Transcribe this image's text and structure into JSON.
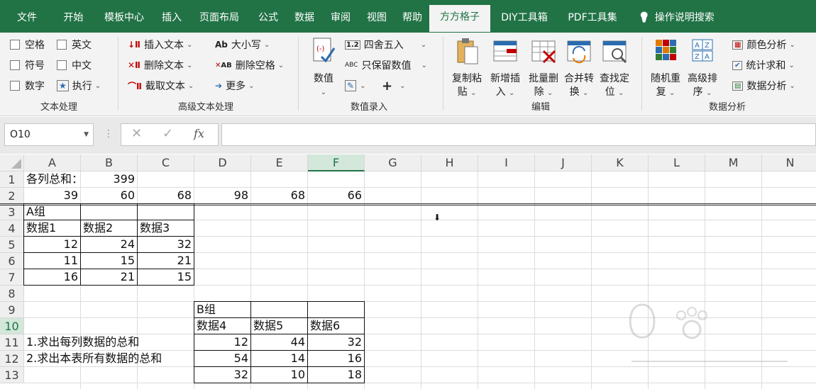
{
  "tabs": [
    "文件",
    "开始",
    "模板中心",
    "插入",
    "页面布局",
    "公式",
    "数据",
    "审阅",
    "视图",
    "帮助",
    "方方格子",
    "DIY工具箱",
    "PDF工具集",
    "操作说明搜索"
  ],
  "ribbon": {
    "text_group": {
      "title": "文本处理",
      "items": [
        "空格",
        "英文",
        "符号",
        "中文",
        "数字",
        "执行"
      ]
    },
    "adv_group": {
      "title": "高级文本处理",
      "items": [
        "插入文本",
        "删除文本",
        "截取文本",
        "大小写",
        "删除空格",
        "更多"
      ]
    },
    "num_group": {
      "title": "数值录入",
      "value_label": "数值",
      "items": [
        "四舍五入",
        "只保留数值"
      ],
      "plus": "+"
    },
    "edit_group": {
      "title": "编辑",
      "buttons": [
        [
          "复制粘",
          "贴"
        ],
        [
          "新增插",
          "入"
        ],
        [
          "批量删",
          "除"
        ],
        [
          "合并转",
          "换"
        ],
        [
          "查找定",
          "位"
        ]
      ]
    },
    "analysis_group": {
      "title": "数据分析",
      "buttons": [
        [
          "随机重",
          "复"
        ],
        [
          "高级排",
          "序"
        ]
      ],
      "items": [
        "颜色分析",
        "统计求和",
        "数据分析"
      ]
    }
  },
  "formula_bar": {
    "name_box": "O10",
    "fx": "fx",
    "formula": ""
  },
  "sheet": {
    "columns": [
      "A",
      "B",
      "C",
      "D",
      "E",
      "F",
      "G",
      "H",
      "I",
      "J",
      "K",
      "L",
      "M",
      "N"
    ],
    "rows": [
      "1",
      "2",
      "3",
      "4",
      "5",
      "6",
      "7",
      "8",
      "9",
      "10",
      "11",
      "12",
      "13"
    ],
    "selected_column": "F",
    "selected_row": "10",
    "cells": {
      "A1": "各列总和：",
      "B1": "399",
      "A2": "39",
      "B2": "60",
      "C2": "68",
      "D2": "98",
      "E2": "68",
      "F2": "66",
      "A3": "A组",
      "A4": "数据1",
      "B4": "数据2",
      "C4": "数据3",
      "A5": "12",
      "B5": "24",
      "C5": "32",
      "A6": "11",
      "B6": "15",
      "C6": "21",
      "A7": "16",
      "B7": "21",
      "C7": "15",
      "D9": "B组",
      "D10": "数据4",
      "E10": "数据5",
      "F10": "数据6",
      "A11": "1.求出每列数据的总和",
      "D11": "12",
      "E11": "44",
      "F11": "32",
      "A12": "2.求出本表所有数据的总和",
      "D12": "54",
      "E12": "14",
      "F12": "16",
      "D13": "32",
      "E13": "10",
      "F13": "18"
    }
  },
  "colors": {
    "accent": "#217346",
    "ribbon_bg": "#f3f3f3"
  }
}
